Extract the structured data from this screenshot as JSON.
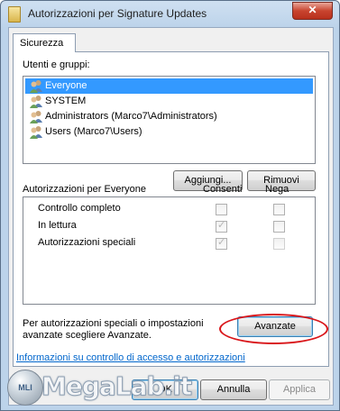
{
  "window": {
    "title": "Autorizzazioni per Signature Updates",
    "close_label": "✕"
  },
  "tab": {
    "label": "Sicurezza"
  },
  "users": {
    "label": "Utenti e gruppi:",
    "items": [
      {
        "name": "Everyone",
        "selected": true
      },
      {
        "name": "SYSTEM",
        "selected": false
      },
      {
        "name": "Administrators (Marco7\\Administrators)",
        "selected": false
      },
      {
        "name": "Users (Marco7\\Users)",
        "selected": false
      }
    ],
    "add_button": "Aggiungi...",
    "remove_button": "Rimuovi"
  },
  "permissions": {
    "header_label": "Autorizzazioni per Everyone",
    "allow_header": "Consenti",
    "deny_header": "Nega",
    "rows": [
      {
        "label": "Controllo completo",
        "allow": false,
        "deny": false
      },
      {
        "label": "In lettura",
        "allow": true,
        "deny": false
      },
      {
        "label": "Autorizzazioni speciali",
        "allow": true,
        "deny": false
      }
    ]
  },
  "advanced": {
    "text_line1": "Per autorizzazioni speciali o impostazioni",
    "text_line2": "avanzate scegliere Avanzate.",
    "button": "Avanzate"
  },
  "help_link": "Informazioni su controllo di accesso e autorizzazioni",
  "footer": {
    "ok": "OK",
    "cancel": "Annulla",
    "apply": "Applica"
  },
  "watermark": {
    "badge": "MLI",
    "text": "MegaLab.it"
  },
  "colors": {
    "selection": "#3399ff",
    "link": "#0066cc",
    "highlight_ellipse": "#d9161a"
  }
}
